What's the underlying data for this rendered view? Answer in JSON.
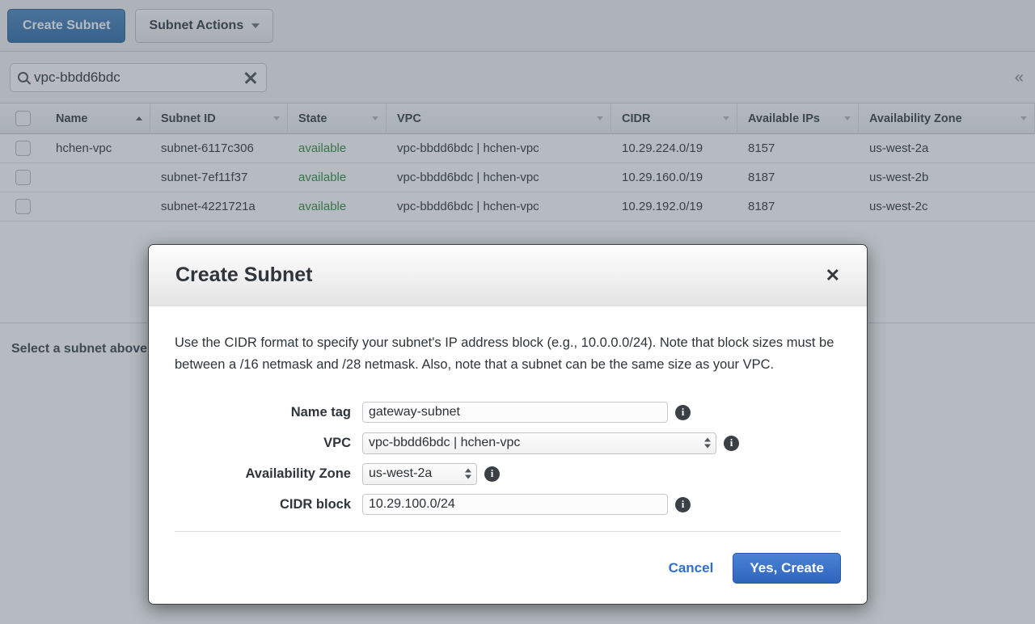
{
  "toolbar": {
    "create_subnet_label": "Create Subnet",
    "subnet_actions_label": "Subnet Actions"
  },
  "search": {
    "value": "vpc-bbdd6bdc",
    "clear_icon": "x-icon",
    "search_icon": "search-icon",
    "collapse_icon": "«"
  },
  "table": {
    "columns": [
      {
        "label": "Name",
        "sort": "asc"
      },
      {
        "label": "Subnet ID",
        "sort": "none"
      },
      {
        "label": "State",
        "sort": "none"
      },
      {
        "label": "VPC",
        "sort": "none"
      },
      {
        "label": "CIDR",
        "sort": "none"
      },
      {
        "label": "Available IPs",
        "sort": "none"
      },
      {
        "label": "Availability Zone",
        "sort": "none"
      }
    ],
    "rows": [
      {
        "name": "hchen-vpc",
        "subnet_id": "subnet-6117c306",
        "state": "available",
        "vpc": "vpc-bbdd6bdc | hchen-vpc",
        "cidr": "10.29.224.0/19",
        "available_ips": "8157",
        "az": "us-west-2a"
      },
      {
        "name": "",
        "subnet_id": "subnet-7ef11f37",
        "state": "available",
        "vpc": "vpc-bbdd6bdc | hchen-vpc",
        "cidr": "10.29.160.0/19",
        "available_ips": "8187",
        "az": "us-west-2b"
      },
      {
        "name": "",
        "subnet_id": "subnet-4221721a",
        "state": "available",
        "vpc": "vpc-bbdd6bdc | hchen-vpc",
        "cidr": "10.29.192.0/19",
        "available_ips": "8187",
        "az": "us-west-2c"
      }
    ]
  },
  "detail_pane": {
    "empty_message": "Select a subnet above"
  },
  "modal": {
    "title": "Create Subnet",
    "close_icon": "✕",
    "description": "Use the CIDR format to specify your subnet's IP address block (e.g., 10.0.0.0/24). Note that block sizes must be between a /16 netmask and /28 netmask. Also, note that a subnet can be the same size as your VPC.",
    "fields": [
      {
        "label": "Name tag",
        "value": "gateway-subnet",
        "type": "text",
        "info": "info-icon"
      },
      {
        "label": "VPC",
        "value": "vpc-bbdd6bdc | hchen-vpc",
        "type": "select",
        "info": "info-icon"
      },
      {
        "label": "Availability Zone",
        "value": "us-west-2a",
        "type": "select",
        "info": "info-icon"
      },
      {
        "label": "CIDR block",
        "value": "10.29.100.0/24",
        "type": "text",
        "info": "info-icon"
      }
    ],
    "cancel_label": "Cancel",
    "create_label": "Yes, Create"
  },
  "colors": {
    "accent_blue": "#2f64bd",
    "link_blue": "#2e6fd0",
    "state_green": "#2e8b3d",
    "overlay": "#9ca5ae"
  }
}
